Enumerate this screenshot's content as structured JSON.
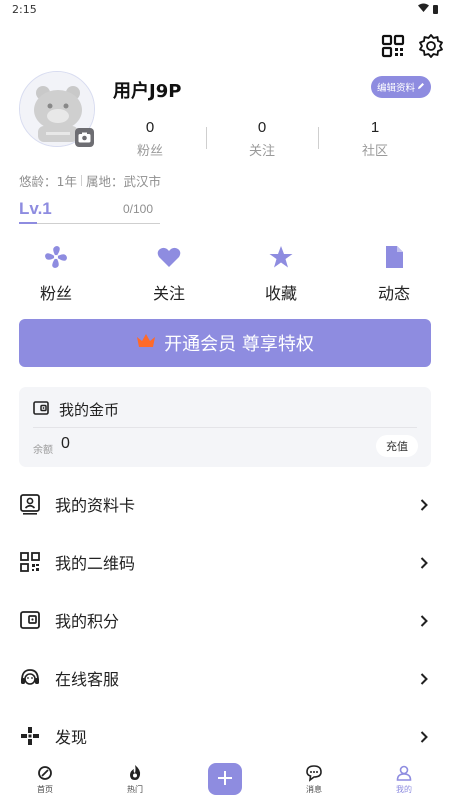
{
  "status_bar": {
    "time": "2:15"
  },
  "profile": {
    "username": "用户J9P",
    "edit_label": "编辑资料",
    "stats": [
      {
        "value": "0",
        "label": "粉丝"
      },
      {
        "value": "0",
        "label": "关注"
      },
      {
        "value": "1",
        "label": "社区"
      }
    ],
    "age_text": "悠龄：1年",
    "location_text": "属地：武汉市",
    "level": "Lv.1",
    "level_progress": "0/100"
  },
  "quick_actions": [
    {
      "label": "粉丝",
      "icon": "fan-icon"
    },
    {
      "label": "关注",
      "icon": "heart-icon"
    },
    {
      "label": "收藏",
      "icon": "star-icon"
    },
    {
      "label": "动态",
      "icon": "document-icon"
    }
  ],
  "vip_banner": {
    "text": "开通会员 尊享特权"
  },
  "wallet": {
    "title": "我的金币",
    "balance_label": "余额",
    "balance": "0",
    "recharge_label": "充值"
  },
  "menu": [
    {
      "label": "我的资料卡",
      "icon": "profile-card-icon"
    },
    {
      "label": "我的二维码",
      "icon": "qr-code-icon"
    },
    {
      "label": "我的积分",
      "icon": "points-wallet-icon"
    },
    {
      "label": "在线客服",
      "icon": "customer-service-icon"
    },
    {
      "label": "发现",
      "icon": "gamepad-icon"
    }
  ],
  "tabbar": {
    "items": [
      {
        "label": "首页",
        "icon": "home-icon"
      },
      {
        "label": "热门",
        "icon": "hot-icon"
      },
      {
        "label": "消息",
        "icon": "message-icon"
      },
      {
        "label": "我的",
        "icon": "user-icon"
      }
    ],
    "active": "我的"
  },
  "colors": {
    "accent": "#8e8ce0",
    "muted_text": "#9a9a9a",
    "card_bg": "#f4f5f8",
    "crown": "#ff6a2a"
  }
}
